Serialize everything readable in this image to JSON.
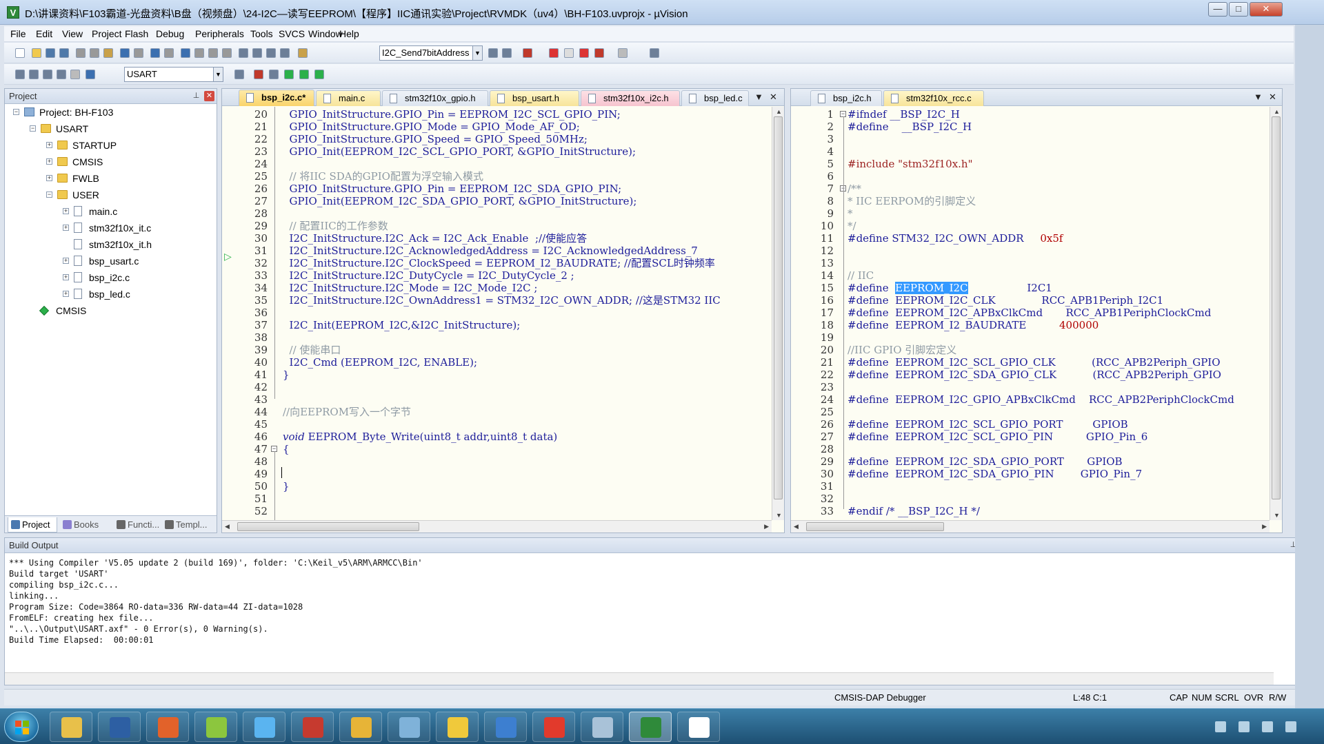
{
  "window": {
    "title": "D:\\讲课资料\\F103霸道-光盘资料\\B盘（视频盘）\\24-I2C—读写EEPROM\\【程序】IIC通讯实验\\Project\\RVMDK（uv4）\\BH-F103.uvprojx - µVision",
    "app_icon_letter": "V",
    "min_label": "—",
    "max_label": "□",
    "close_label": "✕"
  },
  "menu": [
    "File",
    "Edit",
    "View",
    "Project",
    "Flash",
    "Debug",
    "Peripherals",
    "Tools",
    "SVCS",
    "Window",
    "Help"
  ],
  "toolbar": {
    "find_combo_value": "I2C_Send7bitAddress",
    "target_combo_value": "USART"
  },
  "project_panel": {
    "title": "Project",
    "tree": [
      {
        "label": "Project: BH-F103",
        "depth": 0,
        "kind": "proj",
        "expander": "−"
      },
      {
        "label": "USART",
        "depth": 1,
        "kind": "folder",
        "expander": "−"
      },
      {
        "label": "STARTUP",
        "depth": 2,
        "kind": "folder",
        "expander": "+"
      },
      {
        "label": "CMSIS",
        "depth": 2,
        "kind": "folder",
        "expander": "+"
      },
      {
        "label": "FWLB",
        "depth": 2,
        "kind": "folder",
        "expander": "+"
      },
      {
        "label": "USER",
        "depth": 2,
        "kind": "folder",
        "expander": "−"
      },
      {
        "label": "main.c",
        "depth": 3,
        "kind": "file",
        "expander": "+"
      },
      {
        "label": "stm32f10x_it.c",
        "depth": 3,
        "kind": "file",
        "expander": "+"
      },
      {
        "label": "stm32f10x_it.h",
        "depth": 3,
        "kind": "file",
        "expander": ""
      },
      {
        "label": "bsp_usart.c",
        "depth": 3,
        "kind": "file",
        "expander": "+"
      },
      {
        "label": "bsp_i2c.c",
        "depth": 3,
        "kind": "file",
        "expander": "+"
      },
      {
        "label": "bsp_led.c",
        "depth": 3,
        "kind": "file",
        "expander": "+"
      },
      {
        "label": "CMSIS",
        "depth": 1,
        "kind": "gem",
        "expander": ""
      }
    ],
    "tabs": [
      {
        "label": "Project",
        "active": true,
        "color": "#4a78b0"
      },
      {
        "label": "Books",
        "active": false,
        "color": "#8a7fd0"
      },
      {
        "label": "Functi...",
        "active": false,
        "color": "#666666"
      },
      {
        "label": "Templ...",
        "active": false,
        "color": "#666666"
      }
    ]
  },
  "editor_left": {
    "tabs": [
      {
        "label": "bsp_i2c.c*",
        "style": "active"
      },
      {
        "label": "main.c",
        "style": "yellow"
      },
      {
        "label": "stm32f10x_gpio.h",
        "style": "plain"
      },
      {
        "label": "bsp_usart.h",
        "style": "yellow"
      },
      {
        "label": "stm32f10x_i2c.h",
        "style": "pink"
      },
      {
        "label": "bsp_led.c",
        "style": "plain"
      }
    ],
    "lines": [
      {
        "n": "20",
        "t": "  GPIO_InitStructure.GPIO_Pin = EEPROM_I2C_SCL_GPIO_PIN;",
        "c": "code"
      },
      {
        "n": "21",
        "t": "  GPIO_InitStructure.GPIO_Mode = GPIO_Mode_AF_OD;",
        "c": "code"
      },
      {
        "n": "22",
        "t": "  GPIO_InitStructure.GPIO_Speed = GPIO_Speed_50MHz;",
        "c": "code"
      },
      {
        "n": "23",
        "t": "  GPIO_Init(EEPROM_I2C_SCL_GPIO_PORT, &GPIO_InitStructure);",
        "c": "code"
      },
      {
        "n": "24",
        "t": "",
        "c": "code"
      },
      {
        "n": "25",
        "t": "  // 将IIC SDA的GPIO配置为浮空输入模式",
        "c": "cmt"
      },
      {
        "n": "26",
        "t": "  GPIO_InitStructure.GPIO_Pin = EEPROM_I2C_SDA_GPIO_PIN;",
        "c": "code"
      },
      {
        "n": "27",
        "t": "  GPIO_Init(EEPROM_I2C_SDA_GPIO_PORT, &GPIO_InitStructure);",
        "c": "code"
      },
      {
        "n": "28",
        "t": "",
        "c": "code"
      },
      {
        "n": "29",
        "t": "  // 配置IIC的工作参数",
        "c": "cmt"
      },
      {
        "n": "30",
        "t": "  I2C_InitStructure.I2C_Ack = I2C_Ack_Enable  ;//使能应答",
        "c": "code"
      },
      {
        "n": "31",
        "t": "  I2C_InitStructure.I2C_AcknowledgedAddress = I2C_AcknowledgedAddress_7",
        "c": "code"
      },
      {
        "n": "32",
        "t": "  I2C_InitStructure.I2C_ClockSpeed = EEPROM_I2_BAUDRATE; //配置SCL时钟频率",
        "c": "code"
      },
      {
        "n": "33",
        "t": "  I2C_InitStructure.I2C_DutyCycle = I2C_DutyCycle_2 ;",
        "c": "code"
      },
      {
        "n": "34",
        "t": "  I2C_InitStructure.I2C_Mode = I2C_Mode_I2C ;",
        "c": "code"
      },
      {
        "n": "35",
        "t": "  I2C_InitStructure.I2C_OwnAddress1 = STM32_I2C_OWN_ADDR; //这是STM32 IIC",
        "c": "code"
      },
      {
        "n": "36",
        "t": "",
        "c": "code"
      },
      {
        "n": "37",
        "t": "  I2C_Init(EEPROM_I2C,&I2C_InitStructure);",
        "c": "code"
      },
      {
        "n": "38",
        "t": "",
        "c": "code"
      },
      {
        "n": "39",
        "t": "  // 使能串口",
        "c": "cmt"
      },
      {
        "n": "40",
        "t": "  I2C_Cmd (EEPROM_I2C, ENABLE);",
        "c": "code"
      },
      {
        "n": "41",
        "t": "}",
        "c": "code"
      },
      {
        "n": "42",
        "t": "",
        "c": "code"
      },
      {
        "n": "43",
        "t": "",
        "c": "code"
      },
      {
        "n": "44",
        "t": "//向EEPROM写入一个字节",
        "c": "cmt"
      },
      {
        "n": "45",
        "t": "",
        "c": "code"
      },
      {
        "n": "46",
        "t": "void EEPROM_Byte_Write(uint8_t addr,uint8_t data)",
        "c": "vd"
      },
      {
        "n": "47",
        "t": "{",
        "c": "code"
      },
      {
        "n": "48",
        "t": "",
        "c": "code"
      },
      {
        "n": "49",
        "t": "",
        "c": "code"
      },
      {
        "n": "50",
        "t": "}",
        "c": "code"
      },
      {
        "n": "51",
        "t": "",
        "c": "code"
      },
      {
        "n": "52",
        "t": "",
        "c": "code"
      }
    ]
  },
  "editor_right": {
    "tabs": [
      {
        "label": "bsp_i2c.h",
        "style": "plain"
      },
      {
        "label": "stm32f10x_rcc.c",
        "style": "yellow"
      }
    ],
    "lines": [
      {
        "n": "1",
        "t": "#ifndef __BSP_I2C_H",
        "c": "pp"
      },
      {
        "n": "2",
        "t": "#define    __BSP_I2C_H",
        "c": "pp"
      },
      {
        "n": "3",
        "t": "",
        "c": "code"
      },
      {
        "n": "4",
        "t": "",
        "c": "code"
      },
      {
        "n": "5",
        "t": "#include \"stm32f10x.h\"",
        "c": "str"
      },
      {
        "n": "6",
        "t": "",
        "c": "code"
      },
      {
        "n": "7",
        "t": "/**",
        "c": "cmt"
      },
      {
        "n": "8",
        "t": "* IIC EERPOM的引脚定义",
        "c": "cmt"
      },
      {
        "n": "9",
        "t": "*",
        "c": "cmt"
      },
      {
        "n": "10",
        "t": "*/",
        "c": "cmt"
      },
      {
        "n": "11",
        "t": "#define STM32_I2C_OWN_ADDR     0x5f",
        "c": "pp"
      },
      {
        "n": "12",
        "t": "",
        "c": "code"
      },
      {
        "n": "13",
        "t": "",
        "c": "code"
      },
      {
        "n": "14",
        "t": "// IIC",
        "c": "cmt"
      },
      {
        "n": "15",
        "t": "#define  EEPROM_I2C                  I2C1",
        "c": "pp"
      },
      {
        "n": "16",
        "t": "#define  EEPROM_I2C_CLK              RCC_APB1Periph_I2C1",
        "c": "pp"
      },
      {
        "n": "17",
        "t": "#define  EEPROM_I2C_APBxClkCmd       RCC_APB1PeriphClockCmd",
        "c": "pp"
      },
      {
        "n": "18",
        "t": "#define  EEPROM_I2_BAUDRATE          400000",
        "c": "pp"
      },
      {
        "n": "19",
        "t": "",
        "c": "code"
      },
      {
        "n": "20",
        "t": "//IIC GPIO 引脚宏定义",
        "c": "cmt"
      },
      {
        "n": "21",
        "t": "#define  EEPROM_I2C_SCL_GPIO_CLK           (RCC_APB2Periph_GPIO",
        "c": "pp"
      },
      {
        "n": "22",
        "t": "#define  EEPROM_I2C_SDA_GPIO_CLK           (RCC_APB2Periph_GPIO",
        "c": "pp"
      },
      {
        "n": "23",
        "t": "",
        "c": "code"
      },
      {
        "n": "24",
        "t": "#define  EEPROM_I2C_GPIO_APBxClkCmd    RCC_APB2PeriphClockCmd",
        "c": "pp"
      },
      {
        "n": "25",
        "t": "",
        "c": "code"
      },
      {
        "n": "26",
        "t": "#define  EEPROM_I2C_SCL_GPIO_PORT         GPIOB",
        "c": "pp"
      },
      {
        "n": "27",
        "t": "#define  EEPROM_I2C_SCL_GPIO_PIN          GPIO_Pin_6",
        "c": "pp"
      },
      {
        "n": "28",
        "t": "",
        "c": "code"
      },
      {
        "n": "29",
        "t": "#define  EEPROM_I2C_SDA_GPIO_PORT       GPIOB",
        "c": "pp"
      },
      {
        "n": "30",
        "t": "#define  EEPROM_I2C_SDA_GPIO_PIN        GPIO_Pin_7",
        "c": "pp"
      },
      {
        "n": "31",
        "t": "",
        "c": "code"
      },
      {
        "n": "32",
        "t": "",
        "c": "code"
      },
      {
        "n": "33",
        "t": "#endif /* __BSP_I2C_H */",
        "c": "pp"
      }
    ],
    "selected_text": "EEPROM_I2C"
  },
  "build_output": {
    "title": "Build Output",
    "text": "*** Using Compiler 'V5.05 update 2 (build 169)', folder: 'C:\\Keil_v5\\ARM\\ARMCC\\Bin'\nBuild target 'USART'\ncompiling bsp_i2c.c...\nlinking...\nProgram Size: Code=3864 RO-data=336 RW-data=44 ZI-data=1028\nFromELF: creating hex file...\n\"..\\..\\Output\\USART.axf\" - 0 Error(s), 0 Warning(s).\nBuild Time Elapsed:  00:00:01"
  },
  "status": {
    "debugger": "CMSIS-DAP Debugger",
    "cursor": "L:48 C:1",
    "caps": "CAP",
    "num": "NUM",
    "scrl": "SCRL",
    "ovr": "OVR",
    "rw": "R/W"
  },
  "taskbar": {
    "apps": [
      {
        "name": "explorer-app",
        "color": "#e8c04a",
        "active": false
      },
      {
        "name": "powershell-app",
        "color": "#2d5fa3",
        "active": false
      },
      {
        "name": "firefox-app",
        "color": "#e2622a",
        "active": false
      },
      {
        "name": "green-app",
        "color": "#8cc63e",
        "active": false
      },
      {
        "name": "qq-app",
        "color": "#5ab4f0",
        "active": false
      },
      {
        "name": "pdf-app",
        "color": "#c63a2f",
        "active": false
      },
      {
        "name": "wildfire-app",
        "color": "#e7b437",
        "active": false
      },
      {
        "name": "notepad-app",
        "color": "#7fb2d9",
        "active": false
      },
      {
        "name": "help-app",
        "color": "#f0c93b",
        "active": false
      },
      {
        "name": "teamviewer-app",
        "color": "#3d7fd0",
        "active": false
      },
      {
        "name": "g-app",
        "color": "#e23a2c",
        "active": false
      },
      {
        "name": "calculator-app",
        "color": "#a9c2d8",
        "active": false
      },
      {
        "name": "keil-app",
        "color": "#2f8a3a",
        "active": true
      },
      {
        "name": "c-app",
        "color": "#ffffff",
        "active": false
      }
    ]
  }
}
